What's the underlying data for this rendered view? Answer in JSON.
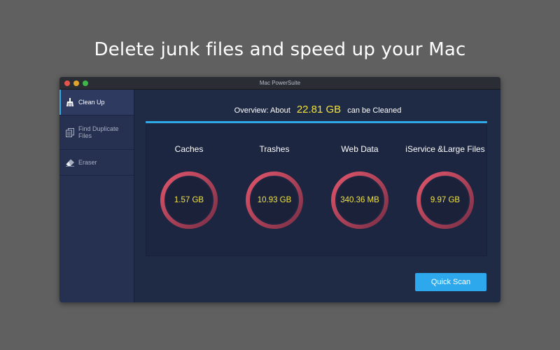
{
  "headline": "Delete junk files and speed up your Mac",
  "window": {
    "title": "Mac PowerSuite"
  },
  "sidebar": {
    "items": [
      {
        "label": "Clean Up",
        "icon": "broom-icon",
        "active": true
      },
      {
        "label": "Find Duplicate Files",
        "icon": "duplicate-files-icon",
        "active": false
      },
      {
        "label": "Eraser",
        "icon": "eraser-icon",
        "active": false
      }
    ]
  },
  "overview": {
    "prefix": "Overview: About",
    "amount": "22.81 GB",
    "suffix": "can be Cleaned"
  },
  "categories": [
    {
      "label": "Caches",
      "value": "1.57 GB"
    },
    {
      "label": "Trashes",
      "value": "10.93 GB"
    },
    {
      "label": "Web Data",
      "value": "340.36 MB"
    },
    {
      "label": "iService &Large Files",
      "value": "9.97 GB"
    }
  ],
  "quick_scan_label": "Quick Scan",
  "colors": {
    "accent": "#2fa8e8",
    "value": "#f2e33a",
    "gauge_start": "#e0556a",
    "gauge_end": "#7a2f47"
  }
}
